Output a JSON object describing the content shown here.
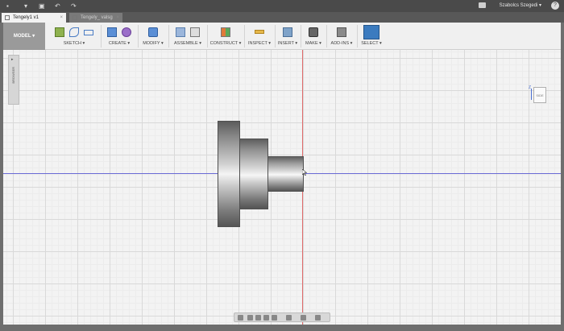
{
  "window": {
    "user_label": "Szabolcs Szegedi ▾",
    "help_label": "?"
  },
  "tabs": [
    {
      "label": "Tengely1 v1",
      "close": "×",
      "active": true
    },
    {
      "label": "Tengely_ valsg v1",
      "close": "×",
      "active": false
    }
  ],
  "toolbar": {
    "workspace": "MODEL ▾",
    "groups": [
      {
        "label": "SKETCH ▾"
      },
      {
        "label": "CREATE ▾"
      },
      {
        "label": "MODIFY ▾"
      },
      {
        "label": "ASSEMBLE ▾"
      },
      {
        "label": "CONSTRUCT ▾"
      },
      {
        "label": "INSPECT ▾"
      },
      {
        "label": "INSERT ▾"
      },
      {
        "label": "MAKE ▾"
      },
      {
        "label": "ADD-INS ▾"
      },
      {
        "label": "SELECT ▾"
      }
    ]
  },
  "browser": {
    "label": "BROWSER",
    "arrow": "▸"
  },
  "viewcube": {
    "face_label": "SIDE",
    "axis_label": "Z"
  },
  "colors": {
    "accent_select": "#3b7bbf",
    "axis_x": "#6b6bd6",
    "axis_y": "#e06b6b"
  }
}
